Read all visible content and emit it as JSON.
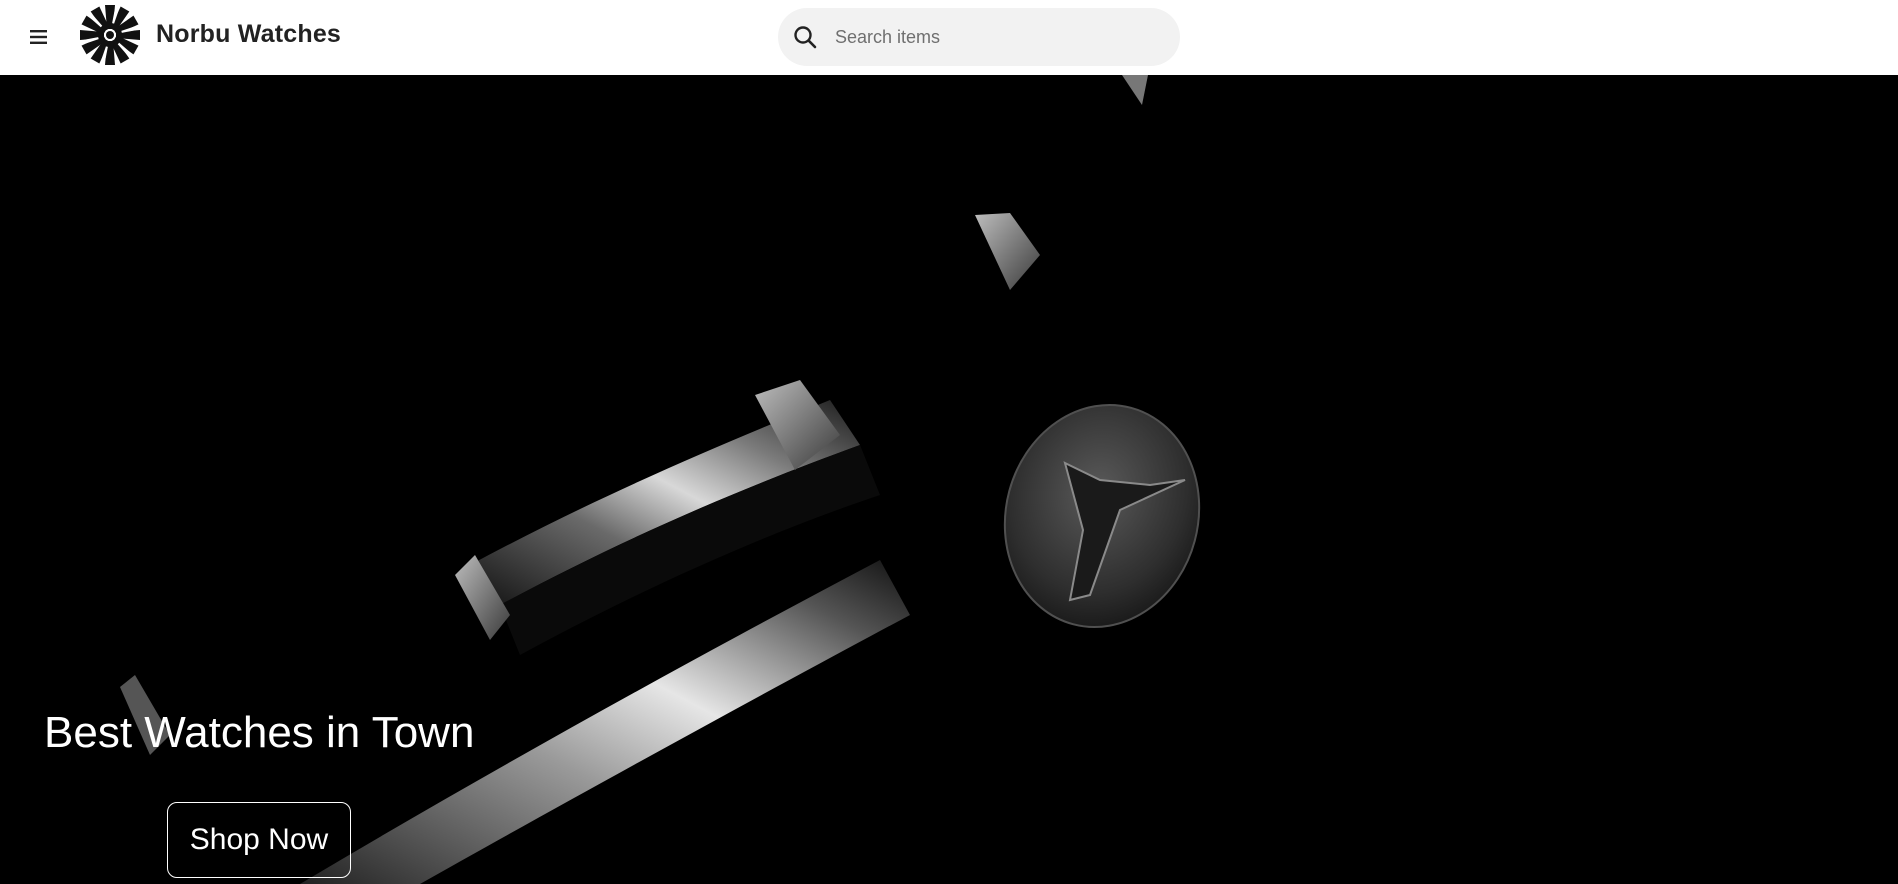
{
  "header": {
    "menu_icon": "hamburger-menu-icon",
    "logo_icon": "starburst-logo-icon",
    "brand_name": "Norbu Watches",
    "search": {
      "icon": "search-icon",
      "placeholder": "Search items",
      "value": ""
    }
  },
  "hero": {
    "headline": "Best Watches in Town",
    "cta_label": "Shop Now",
    "background": "dark close-up watch bezel image"
  },
  "colors": {
    "header_bg": "#ffffff",
    "hero_bg": "#000000",
    "brand_text": "#222222",
    "search_bg": "#f2f2f2",
    "hero_text": "#ffffff"
  }
}
